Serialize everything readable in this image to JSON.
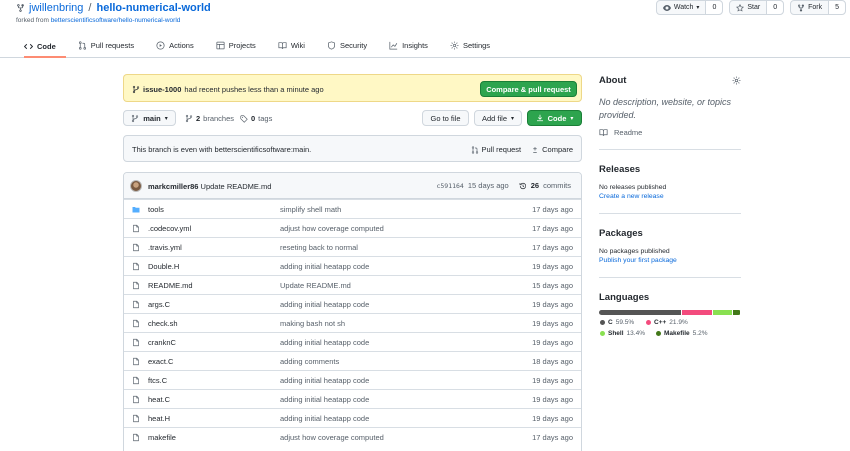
{
  "repo": {
    "owner": "jwillenbring",
    "separator": "/",
    "name": "hello-numerical-world",
    "forked_prefix": "forked from",
    "forked_from": "betterscientificsoftware/hello-numerical-world"
  },
  "header_buttons": {
    "watch_label": "Watch",
    "watch_count": "0",
    "star_label": "Star",
    "star_count": "0",
    "fork_label": "Fork",
    "fork_count": "5"
  },
  "tabs": [
    {
      "label": "Code",
      "icon": "code-icon"
    },
    {
      "label": "Pull requests",
      "icon": "pull-request-icon"
    },
    {
      "label": "Actions",
      "icon": "play-icon"
    },
    {
      "label": "Projects",
      "icon": "table-icon"
    },
    {
      "label": "Wiki",
      "icon": "book-icon"
    },
    {
      "label": "Security",
      "icon": "shield-icon"
    },
    {
      "label": "Insights",
      "icon": "graph-icon"
    },
    {
      "label": "Settings",
      "icon": "gear-icon"
    }
  ],
  "flash": {
    "branch": "issue-1000",
    "message": "had recent pushes less than a minute ago",
    "button": "Compare & pull request"
  },
  "toolbar": {
    "branch": "main",
    "branches_count": "2",
    "branches_label": "branches",
    "tags_count": "0",
    "tags_label": "tags",
    "goto_file": "Go to file",
    "add_file": "Add file",
    "code": "Code"
  },
  "branch_status": {
    "text": "This branch is even with betterscientificsoftware:main.",
    "pull_request": "Pull request",
    "compare": "Compare"
  },
  "latest_commit": {
    "author": "markcmiller86",
    "message": "Update README.md",
    "sha": "c591164",
    "time": "15 days ago",
    "commits_count": "26",
    "commits_label": "commits"
  },
  "files": [
    {
      "name": "tools",
      "type": "dir",
      "message": "simplify shell math",
      "time": "17 days ago"
    },
    {
      "name": ".codecov.yml",
      "type": "file",
      "message": "adjust how coverage computed",
      "time": "17 days ago"
    },
    {
      "name": ".travis.yml",
      "type": "file",
      "message": "reseting back to normal",
      "time": "17 days ago"
    },
    {
      "name": "Double.H",
      "type": "file",
      "message": "adding initial heatapp code",
      "time": "19 days ago"
    },
    {
      "name": "README.md",
      "type": "file",
      "message": "Update README.md",
      "time": "15 days ago"
    },
    {
      "name": "args.C",
      "type": "file",
      "message": "adding initial heatapp code",
      "time": "19 days ago"
    },
    {
      "name": "check.sh",
      "type": "file",
      "message": "making bash not sh",
      "time": "19 days ago"
    },
    {
      "name": "cranknC",
      "type": "file",
      "message": "adding initial heatapp code",
      "time": "19 days ago"
    },
    {
      "name": "exact.C",
      "type": "file",
      "message": "adding comments",
      "time": "18 days ago"
    },
    {
      "name": "ftcs.C",
      "type": "file",
      "message": "adding initial heatapp code",
      "time": "19 days ago"
    },
    {
      "name": "heat.C",
      "type": "file",
      "message": "adding initial heatapp code",
      "time": "19 days ago"
    },
    {
      "name": "heat.H",
      "type": "file",
      "message": "adding initial heatapp code",
      "time": "19 days ago"
    },
    {
      "name": "makefile",
      "type": "file",
      "message": "adjust how coverage computed",
      "time": "17 days ago"
    }
  ],
  "sidebar": {
    "about_title": "About",
    "description": "No description, website, or topics provided.",
    "readme": "Readme",
    "releases_title": "Releases",
    "releases_none": "No releases published",
    "releases_link": "Create a new release",
    "packages_title": "Packages",
    "packages_none": "No packages published",
    "packages_link": "Publish your first package",
    "languages_title": "Languages",
    "languages": [
      {
        "name": "C",
        "percent": "59.5%",
        "value": 59.5,
        "color": "#555555"
      },
      {
        "name": "C++",
        "percent": "21.9%",
        "value": 21.9,
        "color": "#f34b7d"
      },
      {
        "name": "Shell",
        "percent": "13.4%",
        "value": 13.4,
        "color": "#89e051"
      },
      {
        "name": "Makefile",
        "percent": "5.2%",
        "value": 5.2,
        "color": "#427819"
      }
    ]
  },
  "colors": {
    "accent": "#0969da",
    "green": "#2da44e",
    "flash_bg": "#fff8c5",
    "tab_underline": "#fd8c73"
  }
}
